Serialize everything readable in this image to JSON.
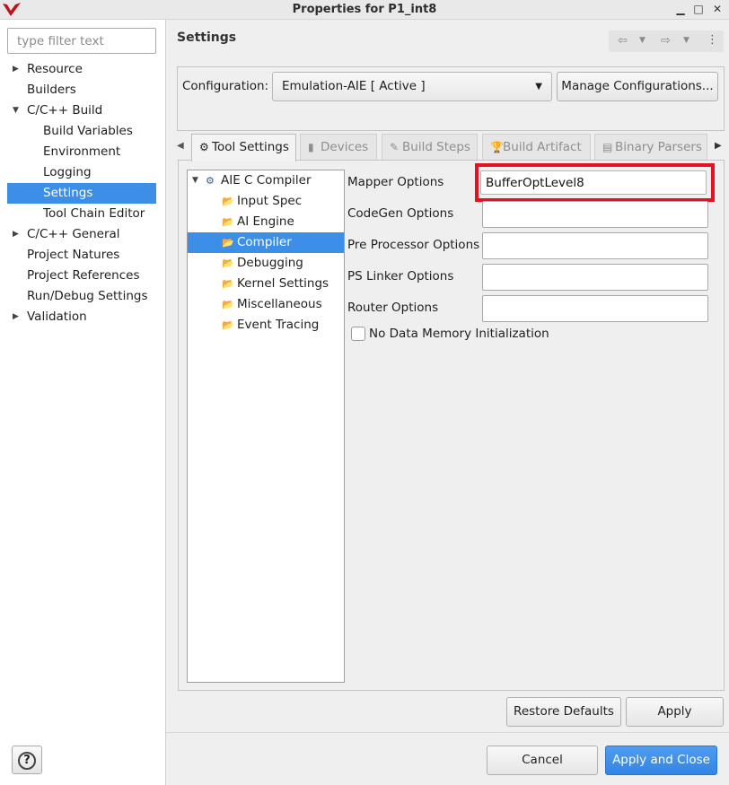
{
  "window": {
    "title": "Properties for P1_int8"
  },
  "filter": {
    "placeholder": "type filter text"
  },
  "nav": {
    "items": [
      {
        "label": "Resource",
        "arrow": "▶"
      },
      {
        "label": "Builders",
        "arrow": ""
      },
      {
        "label": "C/C++ Build",
        "arrow": "▼"
      },
      {
        "label": "Build Variables",
        "arrow": ""
      },
      {
        "label": "Environment",
        "arrow": ""
      },
      {
        "label": "Logging",
        "arrow": ""
      },
      {
        "label": "Settings",
        "arrow": ""
      },
      {
        "label": "Tool Chain Editor",
        "arrow": ""
      },
      {
        "label": "C/C++ General",
        "arrow": "▶"
      },
      {
        "label": "Project Natures",
        "arrow": ""
      },
      {
        "label": "Project References",
        "arrow": ""
      },
      {
        "label": "Run/Debug Settings",
        "arrow": ""
      },
      {
        "label": "Validation",
        "arrow": "▶"
      }
    ]
  },
  "page": {
    "title": "Settings"
  },
  "configuration": {
    "label": "Configuration:",
    "selected": "Emulation-AIE  [ Active ]",
    "manage_label": "Manage Configurations..."
  },
  "tabs": [
    {
      "label": "Tool Settings",
      "icon": "tool-settings-icon"
    },
    {
      "label": "Devices",
      "icon": "devices-icon"
    },
    {
      "label": "Build Steps",
      "icon": "build-steps-icon"
    },
    {
      "label": "Build Artifact",
      "icon": "build-artifact-icon"
    },
    {
      "label": "Binary Parsers",
      "icon": "binary-parsers-icon"
    }
  ],
  "tree": {
    "root": "AIE C Compiler",
    "children": [
      "Input Spec",
      "AI Engine",
      "Compiler",
      "Debugging",
      "Kernel Settings",
      "Miscellaneous",
      "Event Tracing"
    ]
  },
  "fields": {
    "mapper": {
      "label": "Mapper Options",
      "value": "BufferOptLevel8"
    },
    "codegen": {
      "label": "CodeGen Options",
      "value": ""
    },
    "preprocessor": {
      "label": "Pre Processor Options",
      "value": ""
    },
    "pslinker": {
      "label": "PS Linker Options",
      "value": ""
    },
    "router": {
      "label": "Router Options",
      "value": ""
    }
  },
  "checkbox": {
    "label": "No Data Memory Initialization",
    "checked": false
  },
  "buttons": {
    "restore": "Restore Defaults",
    "apply": "Apply",
    "help": "?",
    "cancel": "Cancel",
    "apply_close": "Apply and Close"
  },
  "colors": {
    "selection": "#3d8ee6",
    "highlight_box": "#e8101e",
    "primary_button": "#3a8ae8"
  }
}
